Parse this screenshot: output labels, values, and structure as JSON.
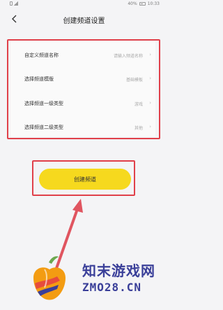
{
  "status_bar": {
    "battery": "40%",
    "time": "10:33"
  },
  "header": {
    "title": "创建频道设置"
  },
  "settings": [
    {
      "label": "自定义频道名称",
      "value": "请输入频道名称"
    },
    {
      "label": "选择频道模版",
      "value": "基础模板"
    },
    {
      "label": "选择频道一级类型",
      "value": "游戏"
    },
    {
      "label": "选择频道二级类型",
      "value": "其他"
    }
  ],
  "actions": {
    "create_label": "创建频道"
  },
  "watermark": {
    "cn": "知末游戏网",
    "en": "ZMO28.CN"
  },
  "colors": {
    "button": "#f6d91e",
    "highlight": "#e0404a",
    "watermark": "#3a3f99"
  }
}
